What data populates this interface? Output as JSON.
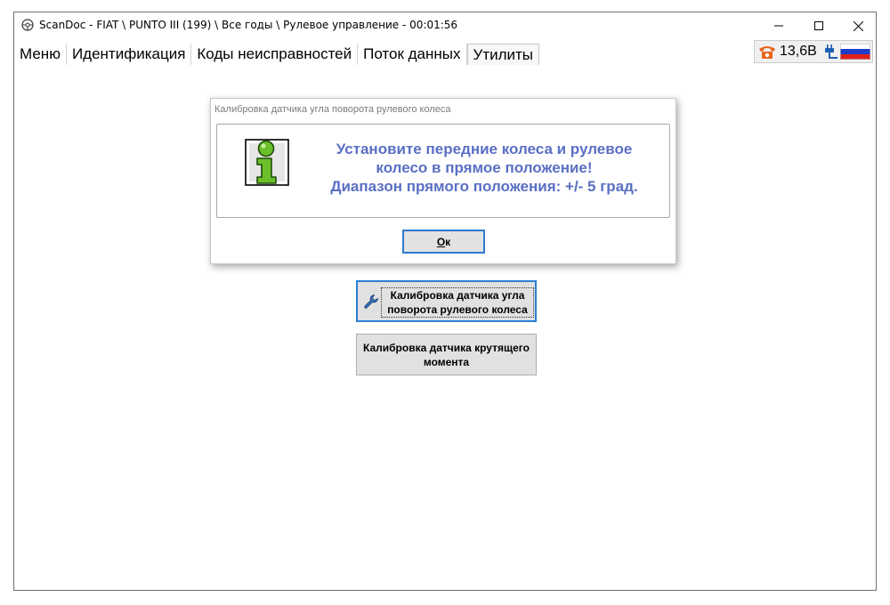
{
  "window": {
    "title": "ScanDoc - FIAT \\ PUNTO III (199) \\ Все годы \\ Рулевое управление - 00:01:56",
    "app_icon": "steering-wheel-icon",
    "controls": [
      "minimize-icon",
      "maximize-icon",
      "close-icon"
    ]
  },
  "menu": {
    "tabs": [
      {
        "label": "Меню"
      },
      {
        "label": "Идентификация"
      },
      {
        "label": "Коды неисправностей"
      },
      {
        "label": "Поток данных"
      },
      {
        "label": "Утилиты",
        "active": true
      }
    ]
  },
  "status": {
    "voltage": "13,6В",
    "icons": [
      "phone-icon",
      "plug-icon",
      "russian-flag-icon"
    ],
    "colors": {
      "phone": "#e8641c",
      "plug": "#1e5fb4",
      "flag_white": "#ffffff",
      "flag_blue": "#1e3cc8",
      "flag_red": "#e0201c"
    }
  },
  "dialog": {
    "title": "Калибровка датчика угла поворота рулевого колеса",
    "message_lines": [
      "Установите передние колеса и рулевое",
      "колесо в прямое положение!",
      "Диапазон прямого положения: +/- 5 град."
    ],
    "message_color": "#5a6fc4",
    "icon": "info-icon",
    "ok_button": {
      "mnemonic": "О",
      "rest": "к"
    }
  },
  "buttons": {
    "steering_calibration": {
      "line1": "Калибровка датчика угла",
      "line2": "поворота рулевого колеса",
      "icon": "wrench-icon"
    },
    "torque_calibration": {
      "line1": "Калибровка датчика крутящего",
      "line2": "момента"
    }
  }
}
